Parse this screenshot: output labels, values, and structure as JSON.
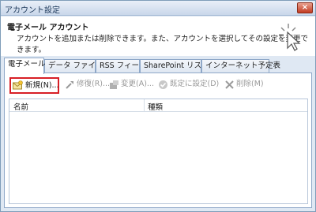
{
  "window": {
    "title": "アカウント設定",
    "close_label": "×"
  },
  "header": {
    "title": "電子メール アカウント",
    "description": "アカウントを追加または削除できます。また、アカウントを選択してその設定を変更できます。"
  },
  "tabs": [
    {
      "label": "電子メール",
      "active": true
    },
    {
      "label": "データ ファイル",
      "active": false
    },
    {
      "label": "RSS フィード",
      "active": false
    },
    {
      "label": "SharePoint リスト",
      "active": false
    },
    {
      "label": "インターネット予定表",
      "active": false
    }
  ],
  "toolbar": {
    "new_label": "新規(N)...",
    "repair_label": "修復(R)...",
    "change_label": "変更(A)...",
    "default_label": "既定に設定(D)",
    "delete_label": "削除(M)"
  },
  "list": {
    "columns": [
      "名前",
      "種類"
    ]
  },
  "colors": {
    "highlight": "#d81f26",
    "title_text": "#1e395b"
  }
}
